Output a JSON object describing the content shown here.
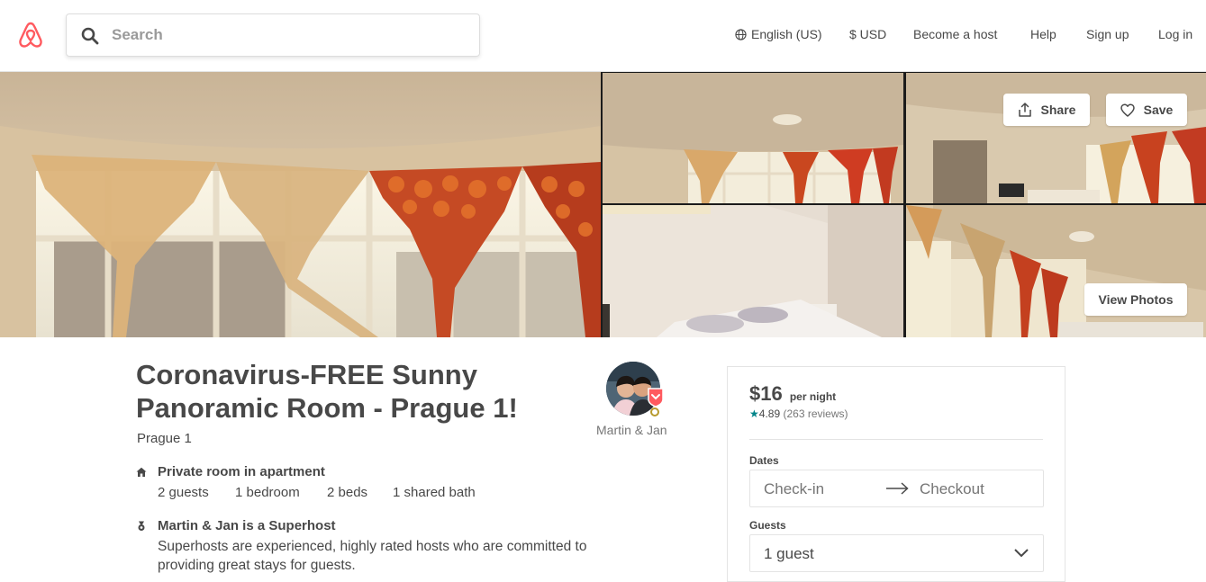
{
  "header": {
    "search_placeholder": "Search",
    "nav": {
      "language": "English (US)",
      "currency": "$ USD",
      "become_host": "Become a host",
      "help": "Help",
      "signup": "Sign up",
      "login": "Log in"
    },
    "brand_color": "#FF5A5F"
  },
  "photos": {
    "share_label": "Share",
    "save_label": "Save",
    "view_photos_label": "View Photos"
  },
  "listing": {
    "title": "Coronavirus-FREE Sunny Panoramic Room - Prague 1!",
    "location": "Prague 1",
    "host_name": "Martin & Jan",
    "features": {
      "room_type": {
        "title": "Private room in apartment",
        "guests": "2 guests",
        "bedrooms": "1 bedroom",
        "beds": "2 beds",
        "baths": "1 shared bath"
      },
      "superhost": {
        "title": "Martin & Jan is a Superhost",
        "description": "Superhosts are experienced, highly rated hosts who are committed to providing great stays for guests."
      }
    }
  },
  "booking": {
    "price": "$16",
    "per_night": "per night",
    "star": "★",
    "rating": "4.89",
    "reviews": "(263 reviews)",
    "dates_label": "Dates",
    "checkin_placeholder": "Check-in",
    "checkout_placeholder": "Checkout",
    "guests_label": "Guests",
    "guests_value": "1 guest",
    "accent_color": "#008489"
  }
}
